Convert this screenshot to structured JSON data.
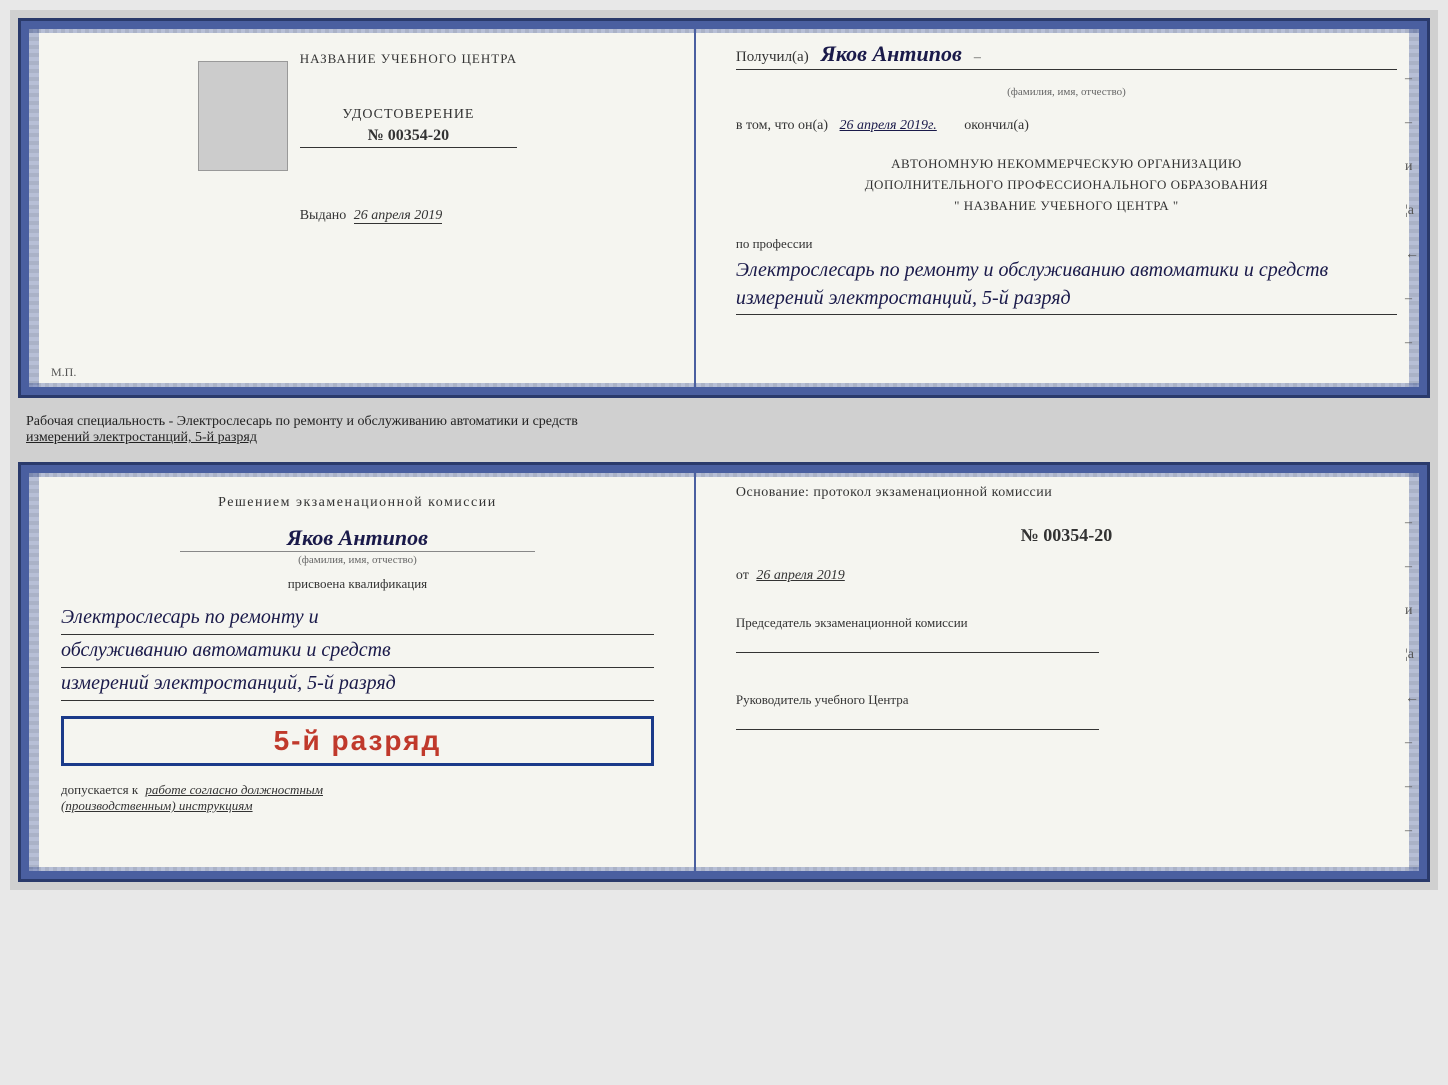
{
  "doc_top": {
    "left": {
      "center_title": "НАЗВАНИЕ УЧЕБНОГО ЦЕНТРА",
      "cert_label": "УДОСТОВЕРЕНИЕ",
      "cert_number": "№ 00354-20",
      "issued_text": "Выдано",
      "issued_date": "26 апреля 2019",
      "mp_label": "М.П."
    },
    "right": {
      "received_prefix": "Получил(а)",
      "recipient_name": "Яков Антипов",
      "fio_label": "(фамилия, имя, отчество)",
      "in_that_prefix": "в том, что он(а)",
      "in_that_date": "26 апреля 2019г.",
      "completed_suffix": "окончил(а)",
      "org_line1": "АВТОНОМНУЮ НЕКОММЕРЧЕСКУЮ ОРГАНИЗАЦИЮ",
      "org_line2": "ДОПОЛНИТЕЛЬНОГО ПРОФЕССИОНАЛЬНОГО ОБРАЗОВАНИЯ",
      "org_line3": "\" НАЗВАНИЕ УЧЕБНОГО ЦЕНТРА \"",
      "profession_label": "по профессии",
      "profession_text": "Электрослесарь по ремонту и обслуживанию автоматики и средств измерений электростанций, 5-й разряд"
    }
  },
  "between_docs": {
    "text1": "Рабочая специальность - Электрослесарь по ремонту и обслуживанию автоматики и средств",
    "text2": "измерений электростанций, 5-й разряд"
  },
  "doc_bottom": {
    "left": {
      "decision_title": "Решением экзаменационной комиссии",
      "name_handwritten": "Яков Антипов",
      "fio_label": "(фамилия, имя, отчество)",
      "qualification_label": "присвоена квалификация",
      "profession_line1": "Электрослесарь по ремонту и",
      "profession_line2": "обслуживанию автоматики и средств",
      "profession_line3": "измерений электростанций, 5-й разряд",
      "grade_text": "5-й разряд",
      "допускается_prefix": "допускается к",
      "допускается_main": "работе согласно должностным",
      "допускается_suffix": "(производственным) инструкциям"
    },
    "right": {
      "basis_text": "Основание: протокол экзаменационной комиссии",
      "protocol_number": "№ 00354-20",
      "date_prefix": "от",
      "date": "26 апреля 2019",
      "chairman_title": "Председатель экзаменационной комиссии",
      "director_title": "Руководитель учебного Центра"
    }
  },
  "right_marks": [
    "–",
    "–",
    "и",
    "¦а",
    "←",
    "–",
    "–",
    "–",
    "–",
    "–"
  ],
  "right_marks_bottom": [
    "–",
    "–",
    "–",
    "и",
    "¦а",
    "←",
    "–",
    "–",
    "–",
    "–",
    "–"
  ]
}
